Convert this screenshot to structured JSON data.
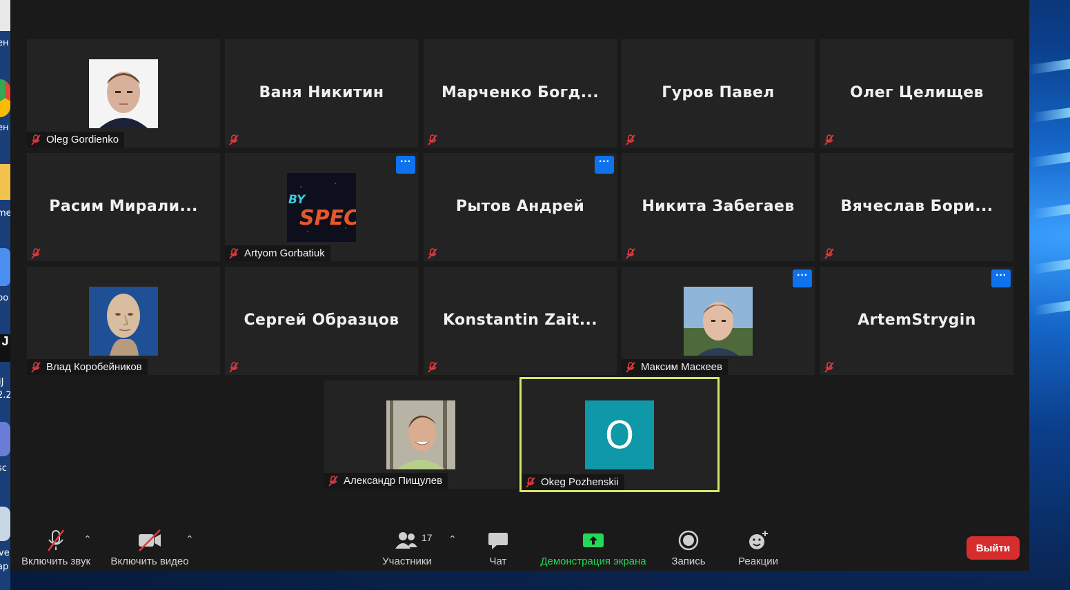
{
  "participants_grid": [
    {
      "name": "Oleg Gordienko",
      "display": "",
      "avatar": "photo-man",
      "more": false
    },
    {
      "name": "",
      "display": "Ваня Никитин",
      "avatar": "",
      "more": false
    },
    {
      "name": "",
      "display": "Марченко  Богд...",
      "avatar": "",
      "more": false
    },
    {
      "name": "",
      "display": "Гуров Павел",
      "avatar": "",
      "more": false
    },
    {
      "name": "",
      "display": "Олег Целищев",
      "avatar": "",
      "more": false
    },
    {
      "name": "",
      "display": "Расим  Мирали...",
      "avatar": "",
      "more": false
    },
    {
      "name": "Artyom Gorbatiuk",
      "display": "",
      "avatar": "byspec-logo",
      "more": true
    },
    {
      "name": "",
      "display": "Рытов Андрей",
      "avatar": "",
      "more": true
    },
    {
      "name": "",
      "display": "Никита Забегаев",
      "avatar": "",
      "more": false
    },
    {
      "name": "",
      "display": "Вячеслав   Бори...",
      "avatar": "",
      "more": false
    },
    {
      "name": "Влад Коробейников",
      "display": "",
      "avatar": "meme-head",
      "more": false
    },
    {
      "name": "",
      "display": "Сергей Образцов",
      "avatar": "",
      "more": false
    },
    {
      "name": "",
      "display": "Konstantin  Zait...",
      "avatar": "",
      "more": false
    },
    {
      "name": "Максим Маскеев",
      "display": "",
      "avatar": "photo-boy",
      "more": true
    },
    {
      "name": "",
      "display": "ArtemStrygin",
      "avatar": "",
      "more": true
    },
    {
      "name": "Александр Пищулев",
      "display": "",
      "avatar": "photo-young-man",
      "more": false
    },
    {
      "name": "Okeg Pozhenskii",
      "display": "",
      "avatar": "initial-tile",
      "initial": "O",
      "more": false,
      "active": true
    }
  ],
  "more_button_label": "···",
  "toolbar": {
    "unmute": "Включить звук",
    "start_video": "Включить видео",
    "participants": "Участники",
    "participants_count": "17",
    "chat": "Чат",
    "share_screen": "Демонстрация экрана",
    "record": "Запись",
    "reactions": "Реакции",
    "leave": "Выйти"
  },
  "desktop_labels": [
    "ен",
    "ен",
    "me",
    "ро",
    "J",
    "iJ",
    "2.2",
    "sc",
    "ve",
    "ap"
  ],
  "colors": {
    "accent_blue": "#0e72ed",
    "leave_red": "#d62e2e",
    "share_green": "#23d959",
    "active_border": "#d7e66b",
    "mic_off_red": "#e0393e",
    "initial_tile": "#0e98a8"
  }
}
